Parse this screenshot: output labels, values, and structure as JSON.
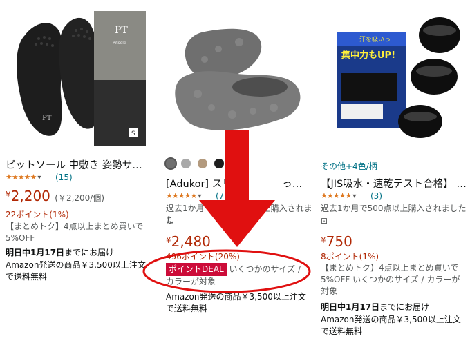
{
  "products": [
    {
      "title": "ピットソール 中敷き 姿勢サポ…",
      "review_count": "(15)",
      "price_yen": "¥",
      "price": "2,200",
      "unit_price": "(￥2,200/個)",
      "points": "22ポイント(1%)",
      "coupon_line1": "【まとめトク】4点以上まとめ買いで",
      "coupon_line2": "5%OFF",
      "delivery_bold": "明日中1月17日",
      "delivery_rest": "までにお届け",
      "shipping_line1": "Amazon発送の商品￥3,500以上注文",
      "shipping_line2": "で送料無料",
      "box_brand": "PT",
      "box_sub": "Pitsole",
      "box_size": "S",
      "rating": 4.5
    },
    {
      "title": "[Adukor] スリ…　　　　った…",
      "review_count": "(73)",
      "bought": "過去1か月で　　　　　　上購入されまし",
      "bought_line2": "た",
      "price_yen": "¥",
      "price": "2,480",
      "points": "496ポイント(20%)",
      "deal_label": "ポイントDEAL",
      "deal_text": "いくつかのサイズ /",
      "deal_text2": "カラーが対象",
      "shipping_line1": "Amazon発送の商品￥3,500以上注文",
      "shipping_line2": "で送料無料",
      "swatch_colors": [
        "#707070",
        "#a9a9a9",
        "#b39a7e",
        "#1e1e1e"
      ],
      "rating": 4.5
    },
    {
      "variants": "その他+4色/柄",
      "title": "【JIS吸水・速乾テスト合格】 …",
      "review_count": "(3)",
      "bought": "過去1か月で500点以上購入されました",
      "price_yen": "¥",
      "price": "750",
      "points": "8ポイント(1%)",
      "coupon_line1": "【まとめトク】4点以上まとめ買いで",
      "coupon_line2": "5%OFF いくつかのサイズ / カラーが",
      "coupon_line3": "対象",
      "delivery_bold": "明日中1月17日",
      "delivery_rest": "までにお届け",
      "shipping_line1": "Amazon発送の商品￥3,500以上注文",
      "shipping_line2": "で送料無料",
      "box_banner": "集中力もUP!",
      "box_top": "汗を吸いっ",
      "rating": 5
    }
  ],
  "annotation": {
    "arrow_color": "#e01010",
    "ellipse_color": "#e01010"
  },
  "stars_text": "★★★★★"
}
